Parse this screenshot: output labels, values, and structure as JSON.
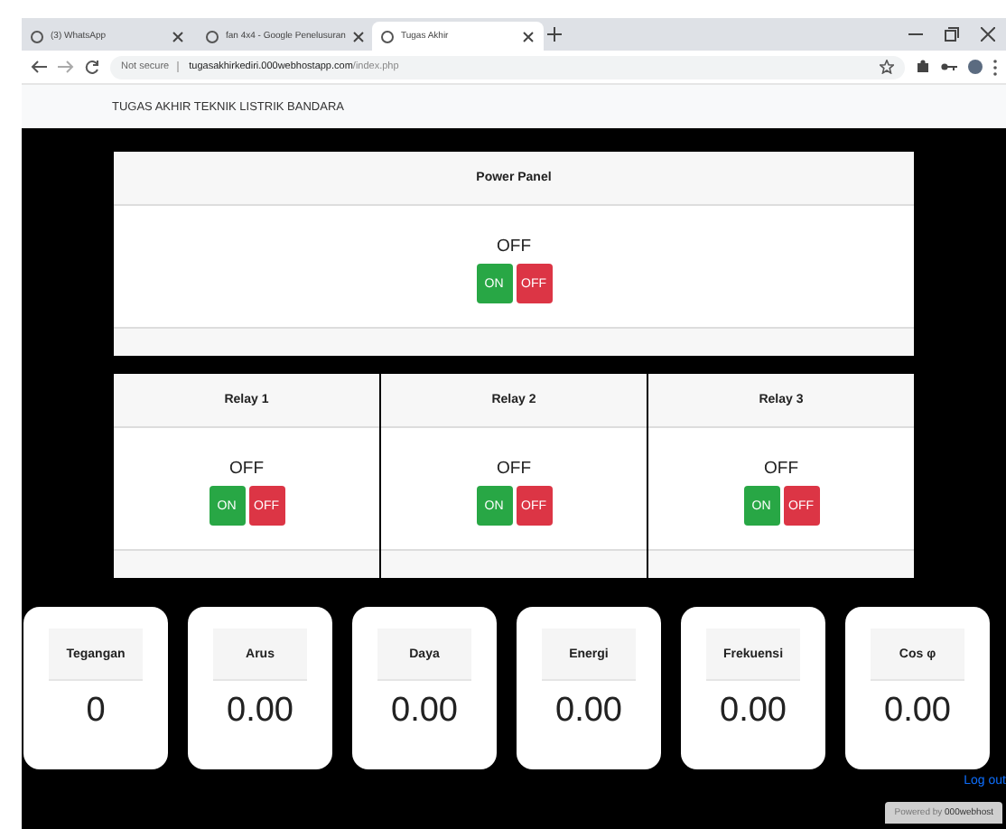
{
  "browser": {
    "tabs": [
      {
        "title": "(3) WhatsApp",
        "selected": false
      },
      {
        "title": "fan 4x4 - Google Penelusuran",
        "selected": false
      },
      {
        "title": "Tugas Akhir",
        "selected": true
      }
    ],
    "security": "Not secure",
    "url_host": "tugasakhirkediri.000webhostapp.com",
    "url_path": "/index.php"
  },
  "navbar": {
    "brand": "TUGAS AKHIR TEKNIK LISTRIK BANDARA"
  },
  "power_panel": {
    "title": "Power Panel",
    "status": "OFF",
    "buttons": [
      {
        "label": "ON",
        "kind": "on"
      },
      {
        "label": "OFF",
        "kind": "off"
      }
    ]
  },
  "relays": [
    {
      "title": "Relay 1",
      "status": "OFF",
      "buttons": [
        {
          "label": "ON",
          "kind": "on"
        },
        {
          "label": "OFF",
          "kind": "off"
        }
      ]
    },
    {
      "title": "Relay 2",
      "status": "OFF",
      "buttons": [
        {
          "label": "ON",
          "kind": "on"
        },
        {
          "label": "OFF",
          "kind": "off"
        }
      ]
    },
    {
      "title": "Relay 3",
      "status": "OFF",
      "buttons": [
        {
          "label": "ON",
          "kind": "on"
        },
        {
          "label": "OFF",
          "kind": "off"
        }
      ]
    }
  ],
  "metrics": [
    {
      "label": "Tegangan",
      "value": "0"
    },
    {
      "label": "Arus",
      "value": "0.00"
    },
    {
      "label": "Daya",
      "value": "0.00"
    },
    {
      "label": "Energi",
      "value": "0.00"
    },
    {
      "label": "Frekuensi",
      "value": "0.00"
    },
    {
      "label": "Cos φ",
      "value": "0.00"
    }
  ],
  "logout": "Log out",
  "hosting_badge": {
    "prefix": "Powered by",
    "name": "000webhost"
  }
}
